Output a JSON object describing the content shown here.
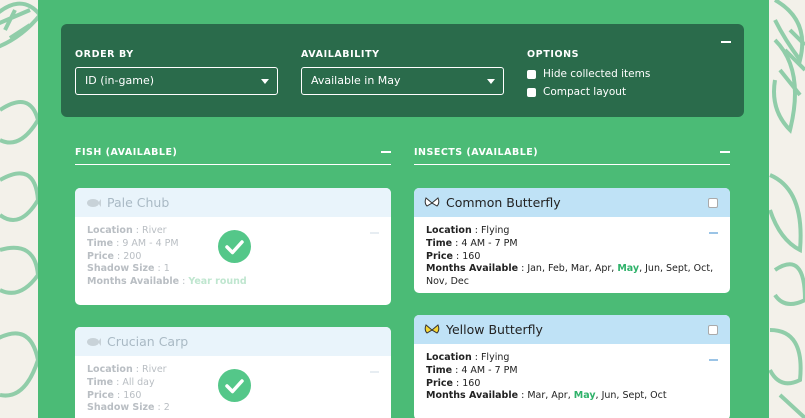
{
  "controls": {
    "order_by": {
      "label": "ORDER BY",
      "value": "ID (in-game)"
    },
    "availability": {
      "label": "AVAILABILITY",
      "value": "Available in May"
    },
    "options": {
      "label": "OPTIONS",
      "items": [
        "Hide collected items",
        "Compact layout"
      ]
    }
  },
  "sections": {
    "fish": {
      "title": "FISH (AVAILABLE)"
    },
    "insects": {
      "title": "INSECTS (AVAILABLE)"
    }
  },
  "field_labels": {
    "location": "Location",
    "time": "Time",
    "price": "Price",
    "shadow_size": "Shadow Size",
    "months": "Months Available"
  },
  "fish": [
    {
      "name": "Pale Chub",
      "location": "River",
      "time": "9 AM - 4 PM",
      "price": "200",
      "shadow_size": "1",
      "months": "Year round",
      "collected": true
    },
    {
      "name": "Crucian Carp",
      "location": "River",
      "time": "All day",
      "price": "160",
      "shadow_size": "2",
      "collected": true
    }
  ],
  "insects": [
    {
      "name": "Common Butterfly",
      "location": "Flying",
      "time": "4 AM - 7 PM",
      "price": "160",
      "months_before": "Jan, Feb, Mar, Apr,",
      "months_highlight": "May",
      "months_after": ", Jun, Sept, Oct, Nov, Dec",
      "icon_color": "#ffffff"
    },
    {
      "name": "Yellow Butterfly",
      "location": "Flying",
      "time": "4 AM - 7 PM",
      "price": "160",
      "months_before": "Mar, Apr,",
      "months_highlight": "May",
      "months_after": ", Jun, Sept, Oct",
      "icon_color": "#f5d635"
    }
  ],
  "colors": {
    "panel": "#4bbb76",
    "controls_bg": "#2a6b4b",
    "highlight": "#2fb26a"
  }
}
